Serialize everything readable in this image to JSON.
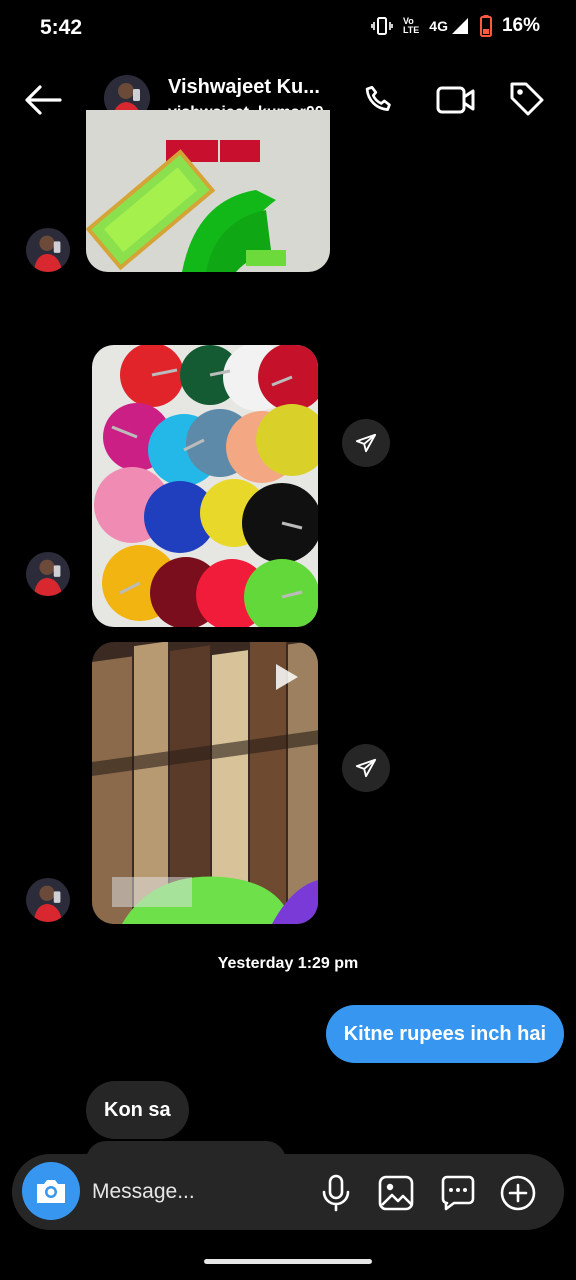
{
  "status_bar": {
    "time": "5:42",
    "volte": "Vo",
    "lte": "LTE",
    "network": "4G",
    "battery": "16%"
  },
  "header": {
    "name": "Vishwajeet Ku...",
    "username": "vishwajeet_kumar00"
  },
  "messages": {
    "timestamp": "Yesterday 1:29 pm",
    "outgoing": "Kitne rupees inch hai",
    "incoming": "Kon sa"
  },
  "composer": {
    "placeholder": "Message..."
  },
  "colors": {
    "accent": "#3797f0",
    "bubble_in": "#262626",
    "background": "#000000"
  },
  "icons": [
    "back-arrow-icon",
    "phone-icon",
    "video-call-icon",
    "tag-icon",
    "forward-icon",
    "play-icon",
    "camera-icon",
    "microphone-icon",
    "gallery-icon",
    "sticker-icon",
    "plus-icon"
  ]
}
